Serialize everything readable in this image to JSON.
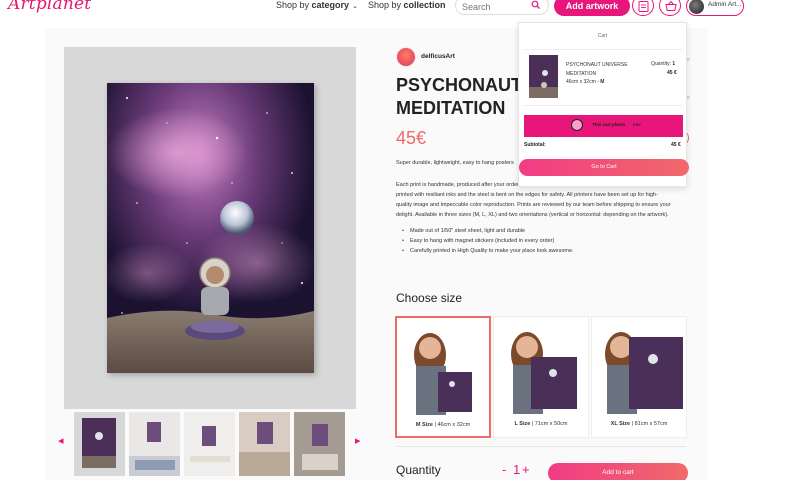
{
  "header": {
    "logo_text": "Artplanet",
    "nav_category_prefix": "Shop by",
    "nav_category_bold": "category",
    "nav_collection_prefix": "Shop by",
    "nav_collection_bold": "collection",
    "search_placeholder": "Search",
    "add_artwork_label": "Add artwork",
    "user_name": "Admin Art..."
  },
  "product": {
    "artist": "delficusArt",
    "title_line1": "PSYCHONAUT UNIVERSE",
    "title_line2": "MEDITATION",
    "price": "45€",
    "short_description": "Super durable, lightweight, easy to hang posters",
    "description_lines": [
      "Each print is handmade, produced after your order",
      "printed with resiliant inks and the steel is bent on the edges for safety. All printers have been set up for high-",
      "quality image and impeccable color reproduction. Prints are reviewed by our team before shipping to ensure your",
      "delight. Available in three sizes (M, L, XL) and two orientations (vertical or horizontal: depending on the artwork)."
    ],
    "bullets": [
      "Made out of 1/50\" steel sheet, light and durable",
      "Easy to hang with magnet stickers (included in every order)",
      "Carefully printed in High Quality to make your place look awesome."
    ]
  },
  "sizes": {
    "heading": "Choose size",
    "options": [
      {
        "code": "M Size",
        "dims": "| 46cm x 32cm",
        "selected": true
      },
      {
        "code": "L Size",
        "dims": "| 71cm x 50cm",
        "selected": false
      },
      {
        "code": "XL Size",
        "dims": "| 81cm x 57cm",
        "selected": false
      }
    ]
  },
  "quantity": {
    "label": "Quantity",
    "minus": "-",
    "value": "1",
    "plus": "+",
    "add_to_cart_label": "Add to cart"
  },
  "cart": {
    "title": "Cart",
    "item_name": "PSYCHONAUT UNIVERSE MEDITATION",
    "item_dims": "46cm x 32cm - ",
    "item_size": "M",
    "item_qty_label": "Quantity:",
    "item_qty": "1",
    "item_price": "45 €",
    "plants_text": "This cart plants",
    "plants_count": "tree",
    "subtotal_label": "Subtotal:",
    "subtotal_value": "45 €",
    "goto_cart_label": "Go to Cart"
  },
  "colors": {
    "brand_pink": "#e8157a",
    "price_coral": "#f06a6a"
  }
}
